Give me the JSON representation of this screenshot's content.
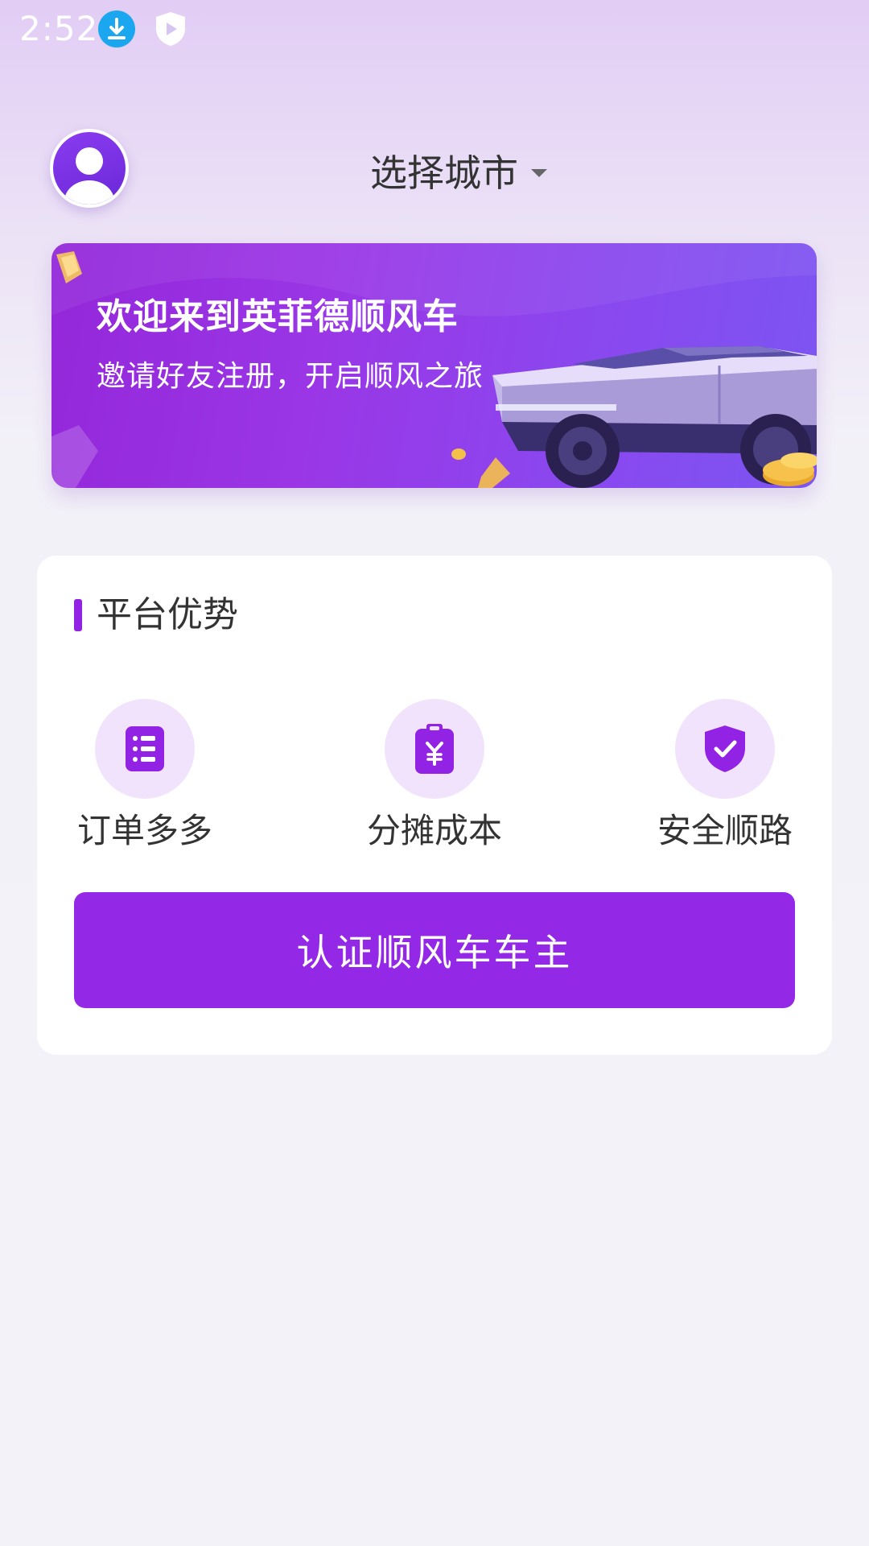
{
  "status_bar": {
    "time": "2:52",
    "icons": [
      "download-icon",
      "shield-icon"
    ]
  },
  "header": {
    "avatar_icon": "user-avatar-icon",
    "city_selector_label": "选择城市",
    "city_selector_icon": "caret-down-icon"
  },
  "banner": {
    "title": "欢迎来到英菲德顺风车",
    "subtitle": "邀请好友注册，开启顺风之旅"
  },
  "advantages": {
    "title": "平台优势",
    "features": [
      {
        "label": "订单多多",
        "icon": "order-list-icon"
      },
      {
        "label": "分摊成本",
        "icon": "yuan-clipboard-icon"
      },
      {
        "label": "安全顺路",
        "icon": "shield-check-icon"
      }
    ]
  },
  "cta": {
    "label": "认证顺风车车主"
  },
  "colors": {
    "primary": "#9329e6",
    "icon_bg": "#f1e3fb",
    "text": "#333333",
    "background": "#f3f2f8"
  }
}
